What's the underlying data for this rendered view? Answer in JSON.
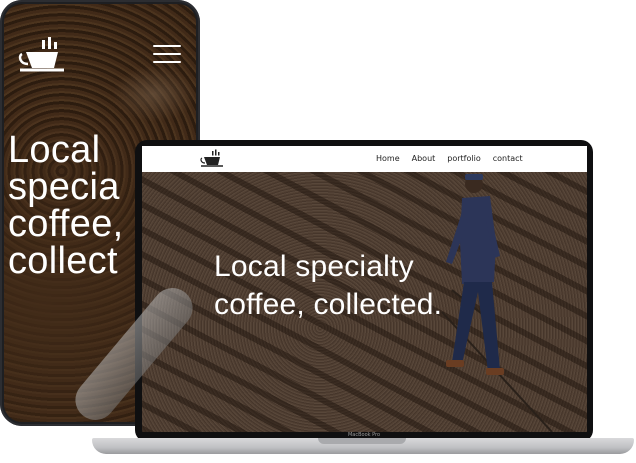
{
  "phone": {
    "headline": "Local\nspecia\ncoffee,\ncollect",
    "menu_label": "menu"
  },
  "laptop": {
    "nav_links": [
      "Home",
      "About",
      "portfolio",
      "contact"
    ],
    "headline": "Local specialty\ncoffee, collected.",
    "device_label": "MacBook Pro"
  },
  "colors": {
    "text_on_image": "#ffffff",
    "nav_text": "#222222",
    "device_frame": "#1e1f22"
  }
}
